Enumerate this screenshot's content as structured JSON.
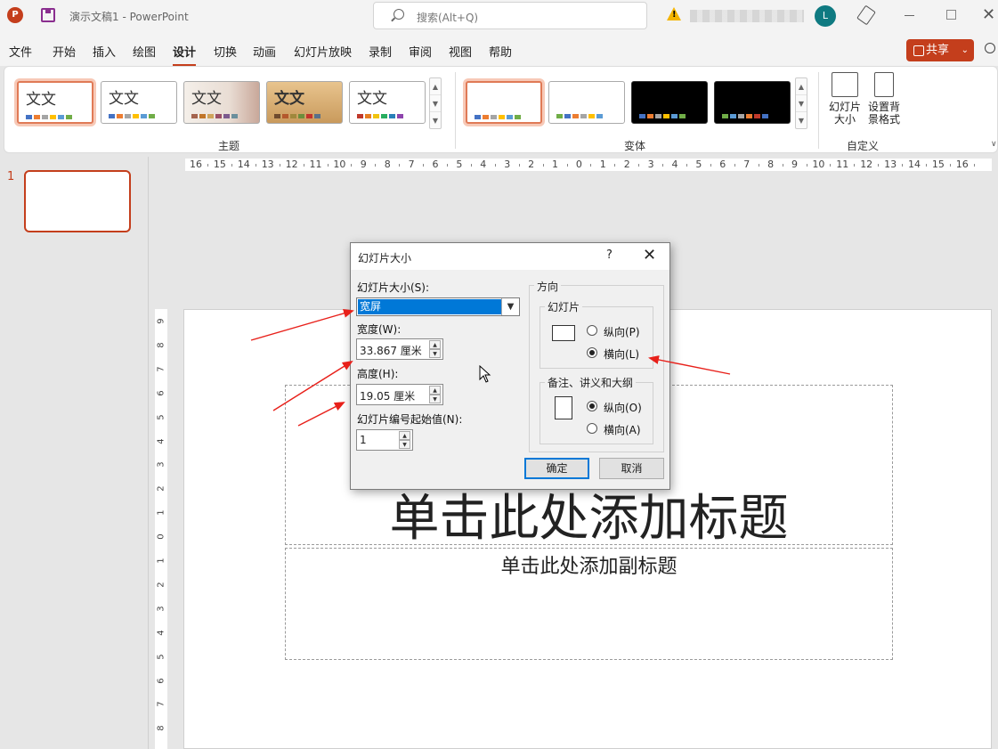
{
  "titlebar": {
    "doc_title": "演示文稿1  -  PowerPoint",
    "search_placeholder": "搜索(Alt+Q)",
    "avatar_letter": "L",
    "app_icon": "P",
    "warning_icon": "!"
  },
  "menu": {
    "tabs": [
      "文件",
      "开始",
      "插入",
      "绘图",
      "设计",
      "切换",
      "动画",
      "幻灯片放映",
      "录制",
      "审阅",
      "视图",
      "帮助"
    ],
    "active_tab": "设计",
    "share_label": "共享"
  },
  "ribbon": {
    "theme_group_label": "主题",
    "variant_group_label": "变体",
    "custom_group_label": "自定义",
    "theme_sample_text": "文文",
    "slide_size_label_1": "幻灯片",
    "slide_size_label_2": "大小",
    "format_bg_label_1": "设置背",
    "format_bg_label_2": "景格式"
  },
  "thumbnails": {
    "slide_number": "1"
  },
  "ruler": {
    "h_labels": [
      "16",
      "15",
      "14",
      "13",
      "12",
      "11",
      "10",
      "9",
      "8",
      "7",
      "6",
      "5",
      "4",
      "3",
      "2",
      "1",
      "0",
      "1",
      "2",
      "3",
      "4",
      "5",
      "6",
      "7",
      "8",
      "9",
      "10",
      "11",
      "12",
      "13",
      "14",
      "15",
      "16"
    ],
    "v_labels": [
      "9",
      "8",
      "7",
      "6",
      "5",
      "4",
      "3",
      "2",
      "1",
      "0",
      "1",
      "2",
      "3",
      "4",
      "5",
      "6",
      "7",
      "8"
    ]
  },
  "slide": {
    "title_placeholder": "单击此处添加标题",
    "subtitle_placeholder": "单击此处添加副标题"
  },
  "dialog": {
    "title": "幻灯片大小",
    "help": "?",
    "close": "✕",
    "size_label": "幻灯片大小(S):",
    "size_value": "宽屏",
    "width_label": "宽度(W):",
    "width_value": "33.867 厘米",
    "height_label": "高度(H):",
    "height_value": "19.05 厘米",
    "number_label": "幻灯片编号起始值(N):",
    "number_value": "1",
    "orientation_label": "方向",
    "slides_label": "幻灯片",
    "portrait_label": "纵向(P)",
    "landscape_label": "横向(L)",
    "notes_label": "备注、讲义和大纲",
    "notes_portrait_label": "纵向(O)",
    "notes_landscape_label": "横向(A)",
    "ok_label": "确定",
    "cancel_label": "取消",
    "slides_orientation": "landscape",
    "notes_orientation": "portrait"
  },
  "colors": {
    "accent": "#c43e1c",
    "annotation_arrow": "#e8201a",
    "selection": "#0078d7"
  }
}
